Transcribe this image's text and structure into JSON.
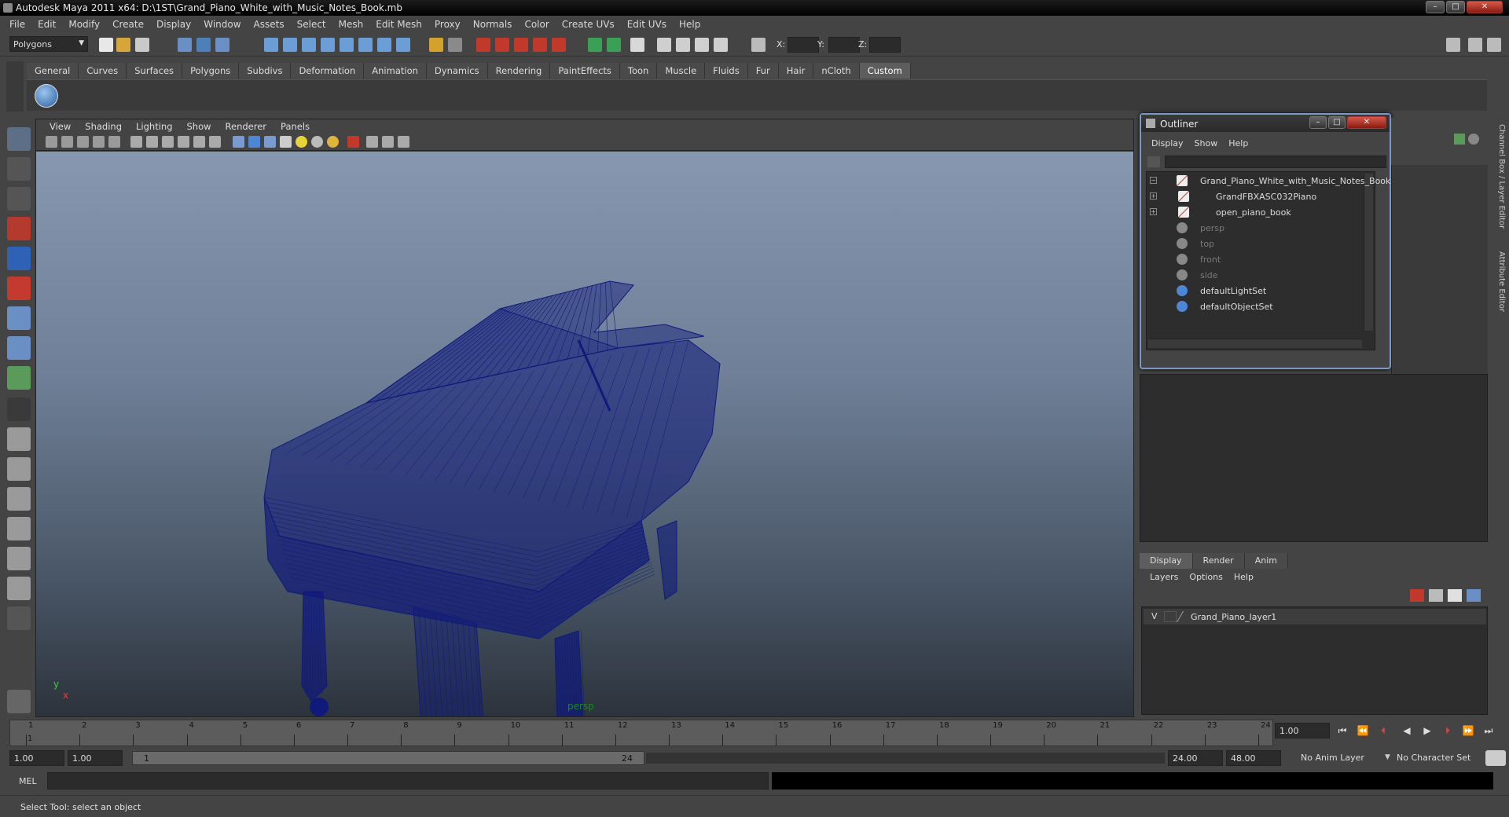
{
  "window": {
    "title": "Autodesk Maya 2011 x64: D:\\1ST\\Grand_Piano_White_with_Music_Notes_Book.mb"
  },
  "menubar": [
    "File",
    "Edit",
    "Modify",
    "Create",
    "Display",
    "Window",
    "Assets",
    "Select",
    "Mesh",
    "Edit Mesh",
    "Proxy",
    "Normals",
    "Color",
    "Create UVs",
    "Edit UVs",
    "Help"
  ],
  "statusline": {
    "mode": "Polygons",
    "x_label": "X:",
    "y_label": "Y:",
    "z_label": "Z:"
  },
  "shelf": {
    "tabs": [
      "General",
      "Curves",
      "Surfaces",
      "Polygons",
      "Subdivs",
      "Deformation",
      "Animation",
      "Dynamics",
      "Rendering",
      "PaintEffects",
      "Toon",
      "Muscle",
      "Fluids",
      "Fur",
      "Hair",
      "nCloth",
      "Custom"
    ],
    "active": "Custom"
  },
  "viewport": {
    "menus": [
      "View",
      "Shading",
      "Lighting",
      "Show",
      "Renderer",
      "Panels"
    ],
    "camera": "persp",
    "axis_y": "y",
    "axis_x": "x",
    "wire_color": "#0f1a7a"
  },
  "outliner": {
    "title": "Outliner",
    "menus": [
      "Display",
      "Show",
      "Help"
    ],
    "items": [
      {
        "label": "Grand_Piano_White_with_Music_Notes_Book",
        "indent": 0,
        "expander": "−",
        "icon": "mesh-icon",
        "dim": false
      },
      {
        "label": "GrandFBXASC032Piano",
        "indent": 1,
        "expander": "+",
        "icon": "mesh-icon",
        "dim": false
      },
      {
        "label": "open_piano_book",
        "indent": 1,
        "expander": "+",
        "icon": "mesh-icon",
        "dim": false
      },
      {
        "label": "persp",
        "indent": 0,
        "expander": "",
        "icon": "camera-icon",
        "dim": true
      },
      {
        "label": "top",
        "indent": 0,
        "expander": "",
        "icon": "camera-icon",
        "dim": true
      },
      {
        "label": "front",
        "indent": 0,
        "expander": "",
        "icon": "camera-icon",
        "dim": true
      },
      {
        "label": "side",
        "indent": 0,
        "expander": "",
        "icon": "camera-icon",
        "dim": true
      },
      {
        "label": "defaultLightSet",
        "indent": 0,
        "expander": "",
        "icon": "set-icon",
        "dim": false
      },
      {
        "label": "defaultObjectSet",
        "indent": 0,
        "expander": "",
        "icon": "set-icon",
        "dim": false
      }
    ]
  },
  "side_tabs": [
    "Channel Box / Layer Editor",
    "Attribute Editor"
  ],
  "layer_editor": {
    "tabs": [
      "Display",
      "Render",
      "Anim"
    ],
    "active": "Display",
    "menus": [
      "Layers",
      "Options",
      "Help"
    ],
    "layer": {
      "visibility": "V",
      "name": "Grand_Piano_layer1"
    }
  },
  "timeline": {
    "ticks": [
      "1",
      "2",
      "3",
      "4",
      "5",
      "6",
      "7",
      "8",
      "9",
      "10",
      "11",
      "12",
      "13",
      "14",
      "15",
      "16",
      "17",
      "18",
      "19",
      "20",
      "21",
      "22",
      "23",
      "24"
    ],
    "current_marker": "1",
    "current_frame": "1.00"
  },
  "range": {
    "start": "1.00",
    "playback_start": "1.00",
    "slider_start": "1",
    "slider_end": "24",
    "playback_end": "24.00",
    "end": "48.00",
    "anim_layer": "No Anim Layer",
    "character_set": "No Character Set"
  },
  "command_line": {
    "label": "MEL"
  },
  "help_line": {
    "text": "Select Tool: select an object"
  }
}
